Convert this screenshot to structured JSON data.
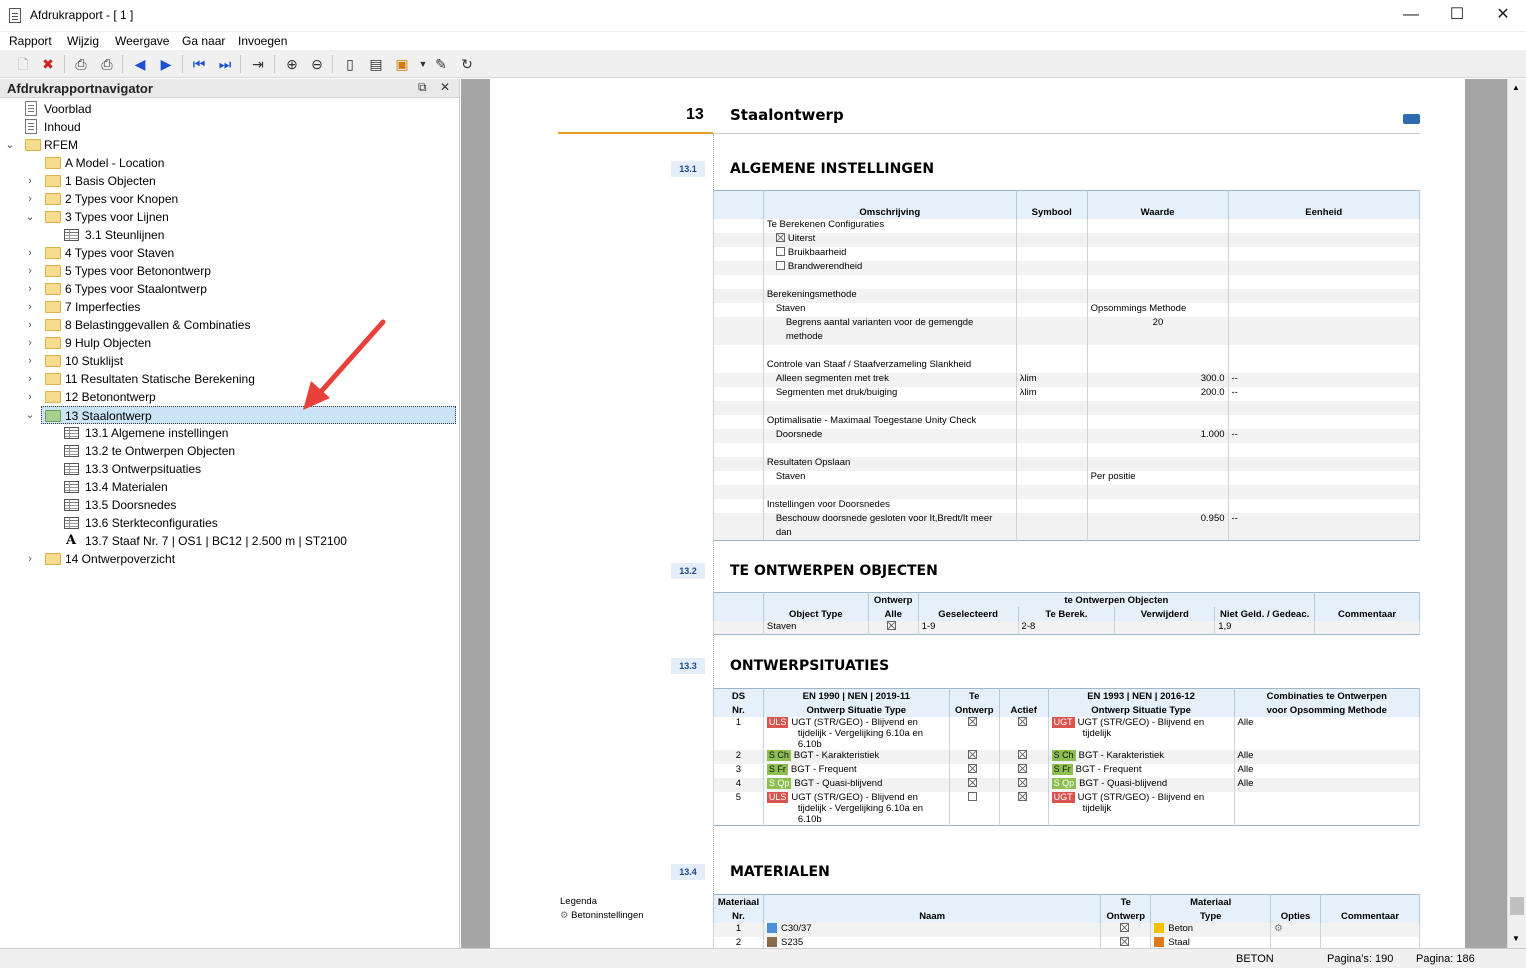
{
  "window": {
    "title": "Afdrukrapport - [ 1 ]"
  },
  "menu": [
    "Rapport",
    "Wijzig",
    "Weergave",
    "Ga naar",
    "Invoegen"
  ],
  "navigator": {
    "title": "Afdrukrapportnavigator",
    "items": [
      {
        "label": "Voorblad"
      },
      {
        "label": "Inhoud"
      },
      {
        "label": "RFEM"
      },
      {
        "label": "A Model - Location"
      },
      {
        "label": "1 Basis Objecten"
      },
      {
        "label": "2 Types voor Knopen"
      },
      {
        "label": "3 Types voor Lijnen"
      },
      {
        "label": "3.1 Steunlijnen"
      },
      {
        "label": "4 Types voor Staven"
      },
      {
        "label": "5 Types voor Betonontwerp"
      },
      {
        "label": "6 Types voor Staalontwerp"
      },
      {
        "label": "7 Imperfecties"
      },
      {
        "label": "8 Belastinggevallen & Combinaties"
      },
      {
        "label": "9 Hulp Objecten"
      },
      {
        "label": "10 Stuklijst"
      },
      {
        "label": "11 Resultaten Statische Berekening"
      },
      {
        "label": "12 Betonontwerp"
      },
      {
        "label": "13 Staalontwerp"
      },
      {
        "label": "13.1 Algemene instellingen"
      },
      {
        "label": "13.2 te Ontwerpen Objecten"
      },
      {
        "label": "13.3 Ontwerpsituaties"
      },
      {
        "label": "13.4 Materialen"
      },
      {
        "label": "13.5 Doorsnedes"
      },
      {
        "label": "13.6 Sterkteconfiguraties"
      },
      {
        "label": "13.7 Staaf Nr. 7 | OS1 | BC12 | 2.500 m | ST2100"
      },
      {
        "label": "14 Ontwerpoverzicht"
      }
    ]
  },
  "report": {
    "chapter_num": "13",
    "chapter_title": "Staalontwerp",
    "s1": {
      "num": "13.1",
      "title": "ALGEMENE INSTELLINGEN",
      "headers": [
        "Omschrijving",
        "Symbool",
        "Waarde",
        "Eenheid"
      ],
      "rows": [
        [
          "Te Berekenen Configuraties",
          "",
          "",
          ""
        ],
        [
          "Uiterst",
          "",
          "",
          ""
        ],
        [
          "Bruikbaarheid",
          "",
          "",
          ""
        ],
        [
          "Brandwerendheid",
          "",
          "",
          ""
        ],
        [
          "",
          "",
          "",
          ""
        ],
        [
          "Berekeningsmethode",
          "",
          "",
          ""
        ],
        [
          "Staven",
          "",
          "Opsommings Methode",
          ""
        ],
        [
          "Begrens aantal varianten voor de gemengde",
          "",
          "20",
          ""
        ],
        [
          "methode",
          "",
          "",
          ""
        ],
        [
          "",
          "",
          "",
          ""
        ],
        [
          "Controle van Staaf / Staafverzameling Slankheid",
          "",
          "",
          ""
        ],
        [
          "Alleen segmenten met trek",
          "λlim",
          "300.0",
          "--"
        ],
        [
          "Segmenten met druk/buiging",
          "λlim",
          "200.0",
          "--"
        ],
        [
          "",
          "",
          "",
          ""
        ],
        [
          "Optimalisatie - Maximaal Toegestane Unity Check",
          "",
          "",
          ""
        ],
        [
          "Doorsnede",
          "",
          "1.000",
          "--"
        ],
        [
          "",
          "",
          "",
          ""
        ],
        [
          "Resultaten Opslaan",
          "",
          "",
          ""
        ],
        [
          "Staven",
          "",
          "Per positie",
          ""
        ],
        [
          "",
          "",
          "",
          ""
        ],
        [
          "Instellingen voor Doorsnedes",
          "",
          "",
          ""
        ],
        [
          "Beschouw doorsnede gesloten voor It,Bredt/It meer",
          "",
          "0.950",
          "--"
        ],
        [
          "dan",
          "",
          "",
          ""
        ]
      ]
    },
    "s2": {
      "num": "13.2",
      "title": "TE ONTWERPEN OBJECTEN",
      "group_header": "te Ontwerpen Objecten",
      "headers": [
        "Object Type",
        "Ontwerp",
        "Alle",
        "Geselecteerd",
        "Te Berek.",
        "Verwijderd",
        "Niet Geld. / Gedeac.",
        "Commentaar"
      ],
      "row": [
        "Staven",
        "",
        "1-9",
        "2-8",
        "",
        "1,9",
        ""
      ]
    },
    "s3": {
      "num": "13.3",
      "title": "ONTWERPSITUATIES",
      "headers": [
        "DS",
        "Nr.",
        "EN 1990 | NEN | 2019-11",
        "Ontwerp Situatie Type",
        "Te",
        "Ontwerp",
        "Actief",
        "EN 1993 | NEN | 2016-12",
        "Ontwerp Situatie Type",
        "Combinaties te Ontwerpen",
        "voor Opsomming Methode"
      ],
      "rows": [
        {
          "nr": "1",
          "b1": "ULS",
          "t1a": "UGT (STR/GEO) - Blijvend en",
          "t1b": "tijdelijk - Vergelijking 6.10a en",
          "t1c": "6.10b",
          "b2": "UGT",
          "t2a": "UGT (STR/GEO) - Blijvend en",
          "t2b": "tijdelijk",
          "comb": "Alle"
        },
        {
          "nr": "2",
          "b1": "S Ch",
          "t1a": "BGT - Karakteristiek",
          "b2": "S Ch",
          "t2a": "BGT - Karakteristiek",
          "comb": "Alle"
        },
        {
          "nr": "3",
          "b1": "S Fr",
          "t1a": "BGT - Frequent",
          "b2": "S Fr",
          "t2a": "BGT - Frequent",
          "comb": "Alle"
        },
        {
          "nr": "4",
          "b1": "S Qp",
          "t1a": "BGT - Quasi-blijvend",
          "b2": "S Qp",
          "t2a": "BGT - Quasi-blijvend",
          "comb": "Alle"
        },
        {
          "nr": "5",
          "b1": "ULS",
          "t1a": "UGT (STR/GEO) - Blijvend en",
          "t1b": "tijdelijk - Vergelijking 6.10a en",
          "t1c": "6.10b",
          "b2": "UGT",
          "t2a": "UGT (STR/GEO) - Blijvend en",
          "t2b": "tijdelijk",
          "comb": ""
        }
      ]
    },
    "s4": {
      "num": "13.4",
      "title": "MATERIALEN",
      "headers": [
        "Materiaal",
        "Nr.",
        "Naam",
        "Te",
        "Ontwerp",
        "Materiaal",
        "Type",
        "Opties",
        "Commentaar"
      ],
      "rows": [
        {
          "nr": "1",
          "name": "C30/37",
          "type": "Beton",
          "color": "#4a90d9",
          "tcolor": "#f2c200"
        },
        {
          "nr": "2",
          "name": "S235",
          "type": "Staal",
          "color": "#8b6b4a",
          "tcolor": "#e07a20"
        }
      ]
    },
    "legenda": {
      "title": "Legenda",
      "item": "Betoninstellingen"
    }
  },
  "status": {
    "left": "BETON",
    "pages": "Pagina's: 190",
    "page": "Pagina: 186"
  }
}
